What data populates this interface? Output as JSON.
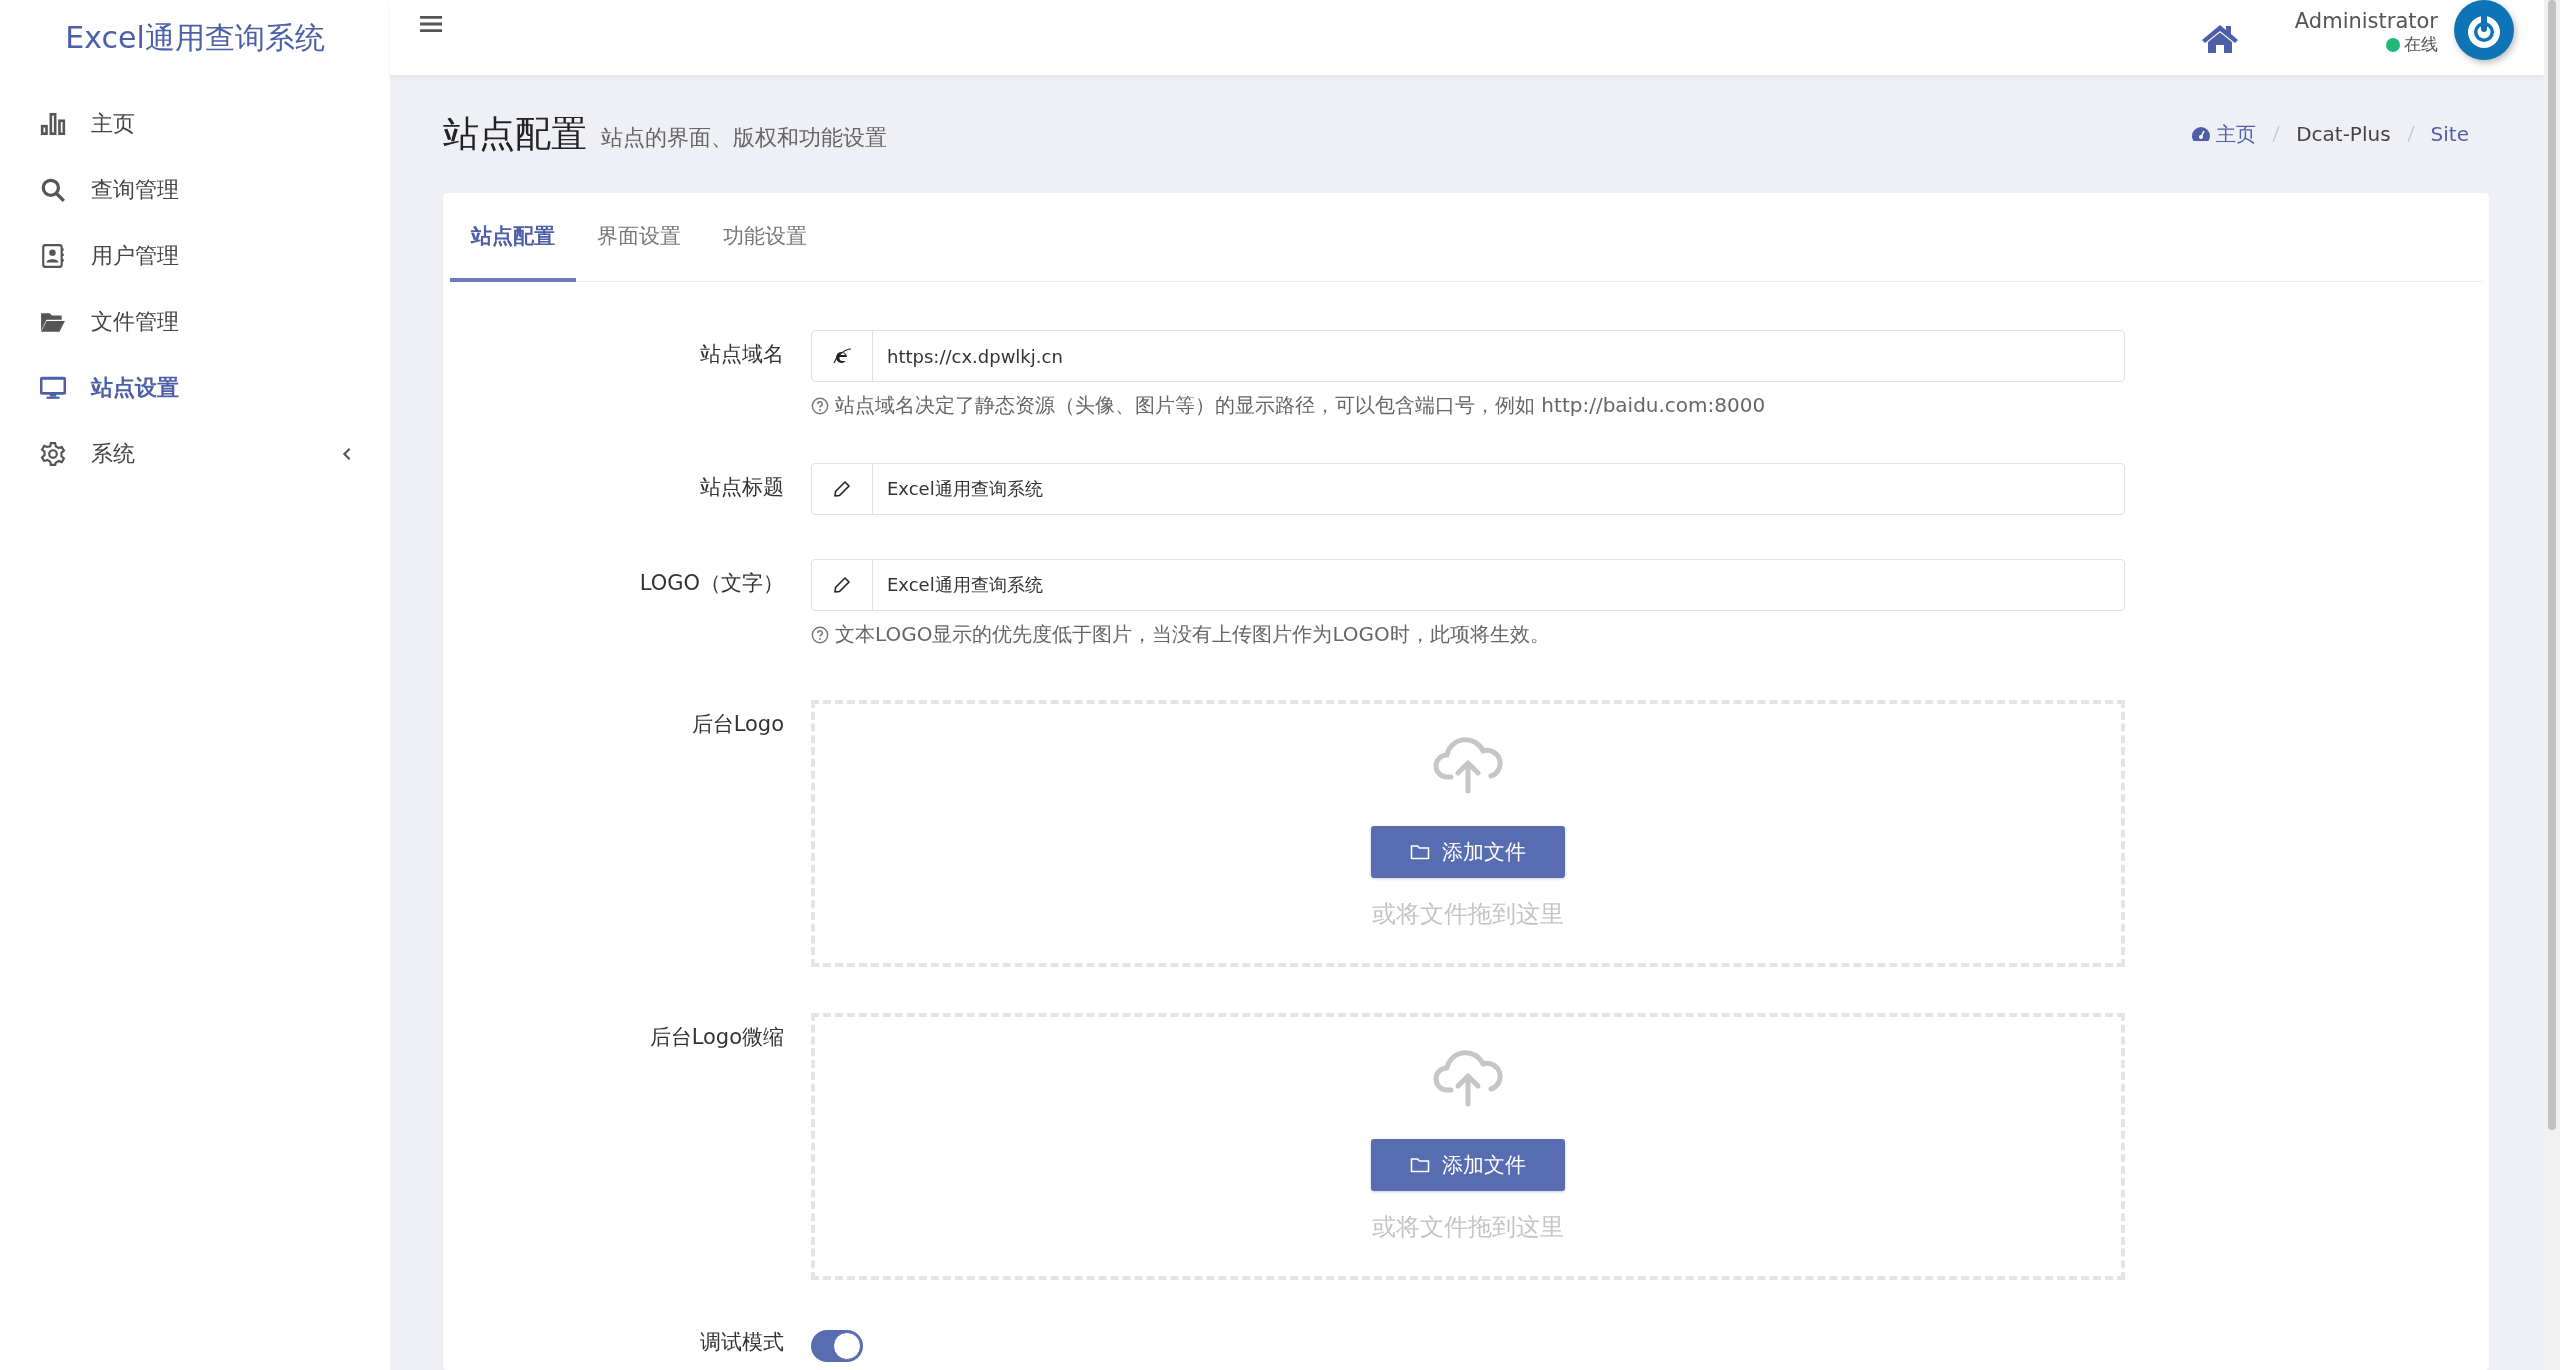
{
  "sidebar": {
    "logo": "Excel通用查询系统",
    "items": [
      {
        "label": "主页",
        "selected": false
      },
      {
        "label": "查询管理",
        "selected": false
      },
      {
        "label": "用户管理",
        "selected": false
      },
      {
        "label": "文件管理",
        "selected": false
      },
      {
        "label": "站点设置",
        "selected": true
      },
      {
        "label": "系统",
        "selected": false,
        "expanded": false
      }
    ]
  },
  "header": {
    "user": {
      "name": "Administrator",
      "status": "在线"
    }
  },
  "page": {
    "title": "站点配置",
    "subtitle": "站点的界面、版权和功能设置",
    "breadcrumb": [
      "主页",
      "Dcat-Plus",
      "Site"
    ]
  },
  "tabs": [
    {
      "label": "站点配置",
      "selected": true
    },
    {
      "label": "界面设置",
      "selected": false
    },
    {
      "label": "功能设置",
      "selected": false
    }
  ],
  "fields": [
    {
      "kind": "url",
      "label": "站点域名",
      "value": "https://cx.dpwlkj.cn",
      "help": "站点域名决定了静态资源（头像、图片等）的显示路径，可以包含端口号，例如 http://baidu.com:8000"
    },
    {
      "kind": "text",
      "label": "站点标题",
      "value": "Excel通用查询系统"
    },
    {
      "kind": "text",
      "label": "LOGO（文字）",
      "value": "Excel通用查询系统",
      "help": "文本LOGO显示的优先度低于图片，当没有上传图片作为LOGO时，此项将生效。"
    },
    {
      "kind": "upload",
      "label": "后台Logo",
      "button": "添加文件",
      "hint": "或将文件拖到这里"
    },
    {
      "kind": "upload",
      "label": "后台Logo微缩",
      "button": "添加文件",
      "hint": "或将文件拖到这里"
    },
    {
      "kind": "switch",
      "label": "调试模式",
      "on": true
    }
  ]
}
